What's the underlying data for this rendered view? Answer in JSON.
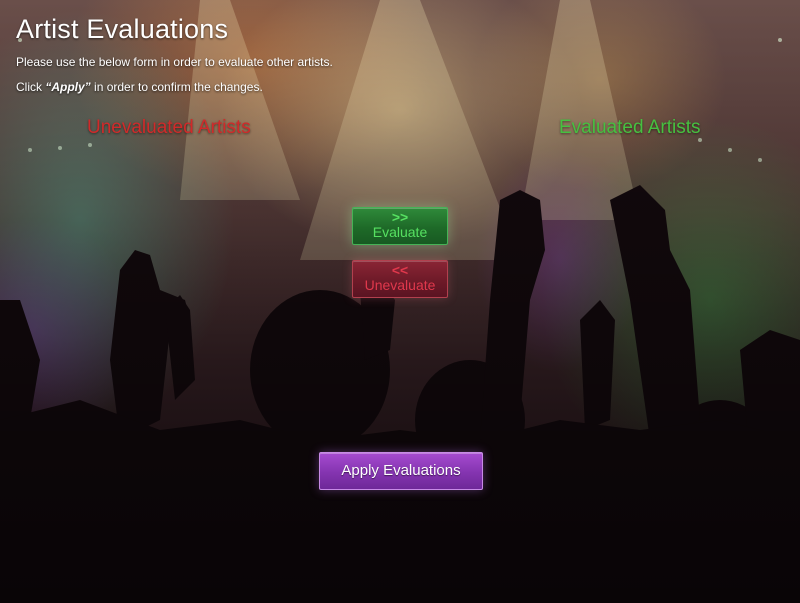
{
  "page": {
    "title": "Artist Evaluations",
    "instruction_line1": "Please use the below form in order to evaluate other artists.",
    "instruction_line2_prefix": "Click ",
    "instruction_line2_bold": "“Apply”",
    "instruction_line2_suffix": " in order to confirm the changes."
  },
  "columns": {
    "unevaluated_label": "Unevaluated Artists",
    "evaluated_label": "Evaluated Artists"
  },
  "buttons": {
    "evaluate_arrows": ">>",
    "evaluate_label": "Evaluate",
    "unevaluate_arrows": "<<",
    "unevaluate_label": "Unevaluate",
    "apply_label": "Apply Evaluations"
  },
  "colors": {
    "unevaluated_heading": "#d02a2a",
    "evaluated_heading": "#46c040",
    "evaluate_button": "#1e6a28",
    "unevaluate_button": "#6e1a28",
    "apply_button": "#8434b0"
  },
  "background": {
    "description_icon": "concert-crowd-image"
  }
}
